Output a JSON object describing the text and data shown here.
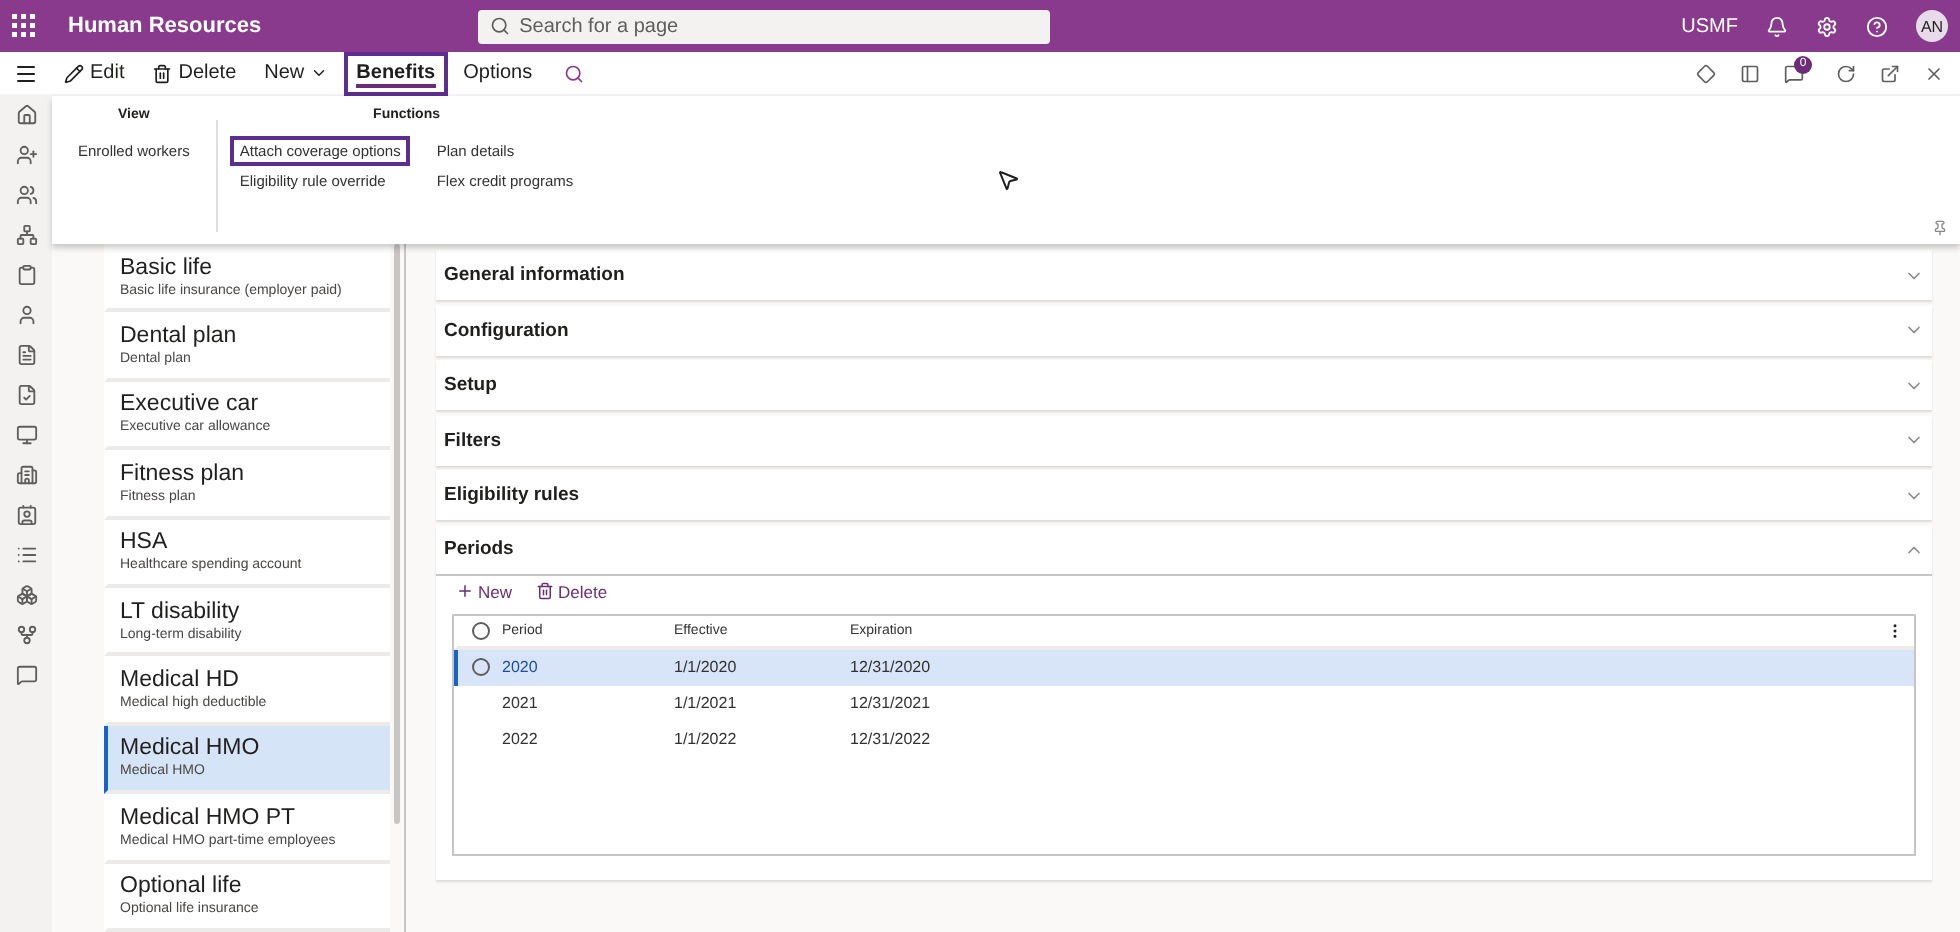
{
  "app_bar": {
    "app_name": "Human Resources",
    "search": {
      "placeholder": "Search for a page"
    },
    "company": "USMF",
    "avatar": "AN"
  },
  "action_pane": {
    "items": [
      {
        "label": "Edit",
        "kind": "edit",
        "selected": false,
        "highlighted": false
      },
      {
        "label": "Delete",
        "kind": "delete",
        "selected": false,
        "highlighted": false
      },
      {
        "label": "New",
        "kind": "menu",
        "selected": false,
        "highlighted": false
      },
      {
        "label": "Benefits",
        "kind": "tab",
        "selected": true,
        "highlighted": true
      },
      {
        "label": "Options",
        "kind": "tab",
        "selected": false,
        "highlighted": false
      }
    ],
    "message_count": "0"
  },
  "ribbon": {
    "groups": [
      {
        "title": "View",
        "items": [
          {
            "label": "Enrolled workers",
            "highlighted": false
          }
        ]
      },
      {
        "title": "Functions",
        "items": [
          {
            "label": "Attach coverage options",
            "highlighted": true
          },
          {
            "label": "Eligibility rule override",
            "highlighted": false
          },
          {
            "label": "Plan details",
            "highlighted": false
          },
          {
            "label": "Flex credit programs",
            "highlighted": false
          }
        ]
      }
    ]
  },
  "plans": [
    {
      "name": "Basic life",
      "description": "Basic life insurance (employer paid)",
      "selected": false
    },
    {
      "name": "Dental plan",
      "description": "Dental plan",
      "selected": false
    },
    {
      "name": "Executive car",
      "description": "Executive car allowance",
      "selected": false
    },
    {
      "name": "Fitness plan",
      "description": "Fitness plan",
      "selected": false
    },
    {
      "name": "HSA",
      "description": "Healthcare spending account",
      "selected": false
    },
    {
      "name": "LT disability",
      "description": "Long-term disability",
      "selected": false
    },
    {
      "name": "Medical HD",
      "description": "Medical high deductible",
      "selected": false
    },
    {
      "name": "Medical HMO",
      "description": "Medical HMO",
      "selected": true
    },
    {
      "name": "Medical HMO PT",
      "description": "Medical HMO part-time employees",
      "selected": false
    },
    {
      "name": "Optional life",
      "description": "Optional life insurance",
      "selected": false
    }
  ],
  "sections": [
    {
      "title": "General information",
      "expanded": false
    },
    {
      "title": "Configuration",
      "expanded": false
    },
    {
      "title": "Setup",
      "expanded": false
    },
    {
      "title": "Filters",
      "expanded": false
    },
    {
      "title": "Eligibility rules",
      "expanded": false
    },
    {
      "title": "Periods",
      "expanded": true
    }
  ],
  "periods": {
    "toolbar": [
      "New",
      "Delete"
    ],
    "all_selected": false,
    "columns": [
      "Period",
      "Effective",
      "Expiration"
    ],
    "rows": [
      {
        "cells": [
          "2020",
          "1/1/2020",
          "12/31/2020"
        ],
        "selected": true
      },
      {
        "cells": [
          "2021",
          "1/1/2021",
          "12/31/2021"
        ],
        "selected": false
      },
      {
        "cells": [
          "2022",
          "1/1/2022",
          "12/31/2022"
        ],
        "selected": false
      }
    ]
  }
}
